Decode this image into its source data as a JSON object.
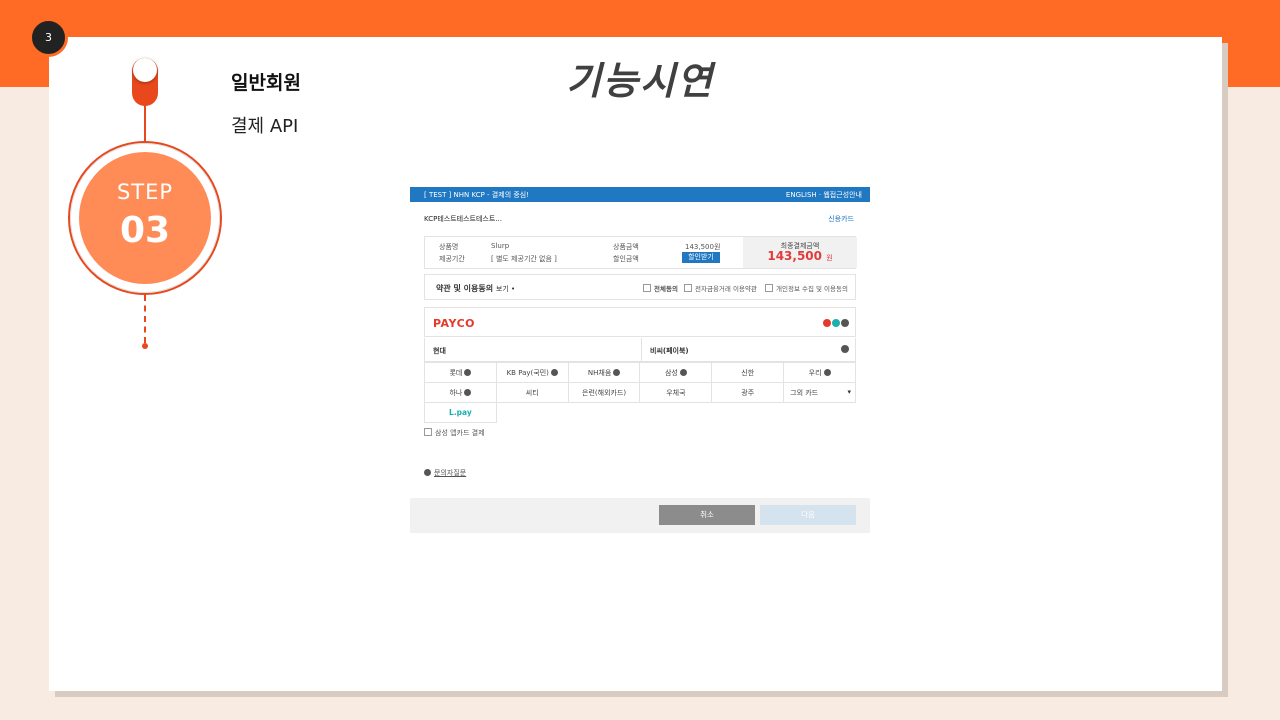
{
  "slide": {
    "page_number": "3",
    "title": "기능시연",
    "subtitle": "일반회원",
    "subtitle2": "결제 API",
    "step_label": "STEP",
    "step_number": "03"
  },
  "colors": {
    "accent": "#ff6a24",
    "step_fill": "#ff8c57",
    "line": "#e8481b",
    "kcp_blue": "#1f78c1"
  },
  "payment_window": {
    "header_left": "[ TEST ] NHN KCP - 결제의 중심!",
    "header_right": "ENGLISH · 웹접근성안내",
    "merchant": "KCP테스트테스트테스트...",
    "payment_type": "신용카드",
    "info": {
      "product_name_label": "상품명",
      "product_name": "Slurp",
      "period_label": "제공기간",
      "period": "[ 별도 제공기간 없음 ]",
      "price_label": "상품금액",
      "price": "143,500원",
      "discount_label": "할인금액",
      "discount_button": "할인받기",
      "total_label": "최종결제금액",
      "total_value": "143,500",
      "total_unit": "원"
    },
    "terms": {
      "title": "약관 및 이용동의",
      "view": "보기 •",
      "agree_all": "전체동의",
      "agree_efinance": "전자금융거래 이용약관",
      "agree_privacy": "개인정보 수집 및 이용동의"
    },
    "payco": "PAYCO",
    "group_left": "현대",
    "group_right": "비씨(페이북)",
    "cards_row1": [
      "롯데",
      "KB Pay(국민)",
      "NH채움",
      "삼성",
      "신한",
      "우리"
    ],
    "cards_row2": [
      "하나",
      "씨티",
      "은련(해외카드)",
      "우체국",
      "광주",
      "그외 카드"
    ],
    "cards_row3": [
      "L.pay"
    ],
    "samsung_app": "삼성 앱카드 결제",
    "faq": "문의자질문",
    "cancel_button": "취소",
    "next_button": "다음"
  }
}
